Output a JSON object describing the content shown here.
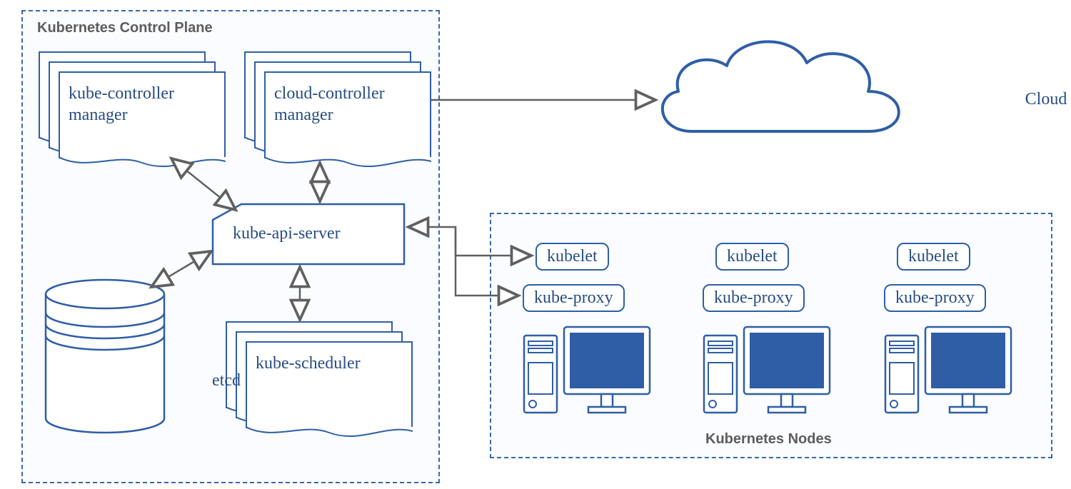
{
  "controlPlane": {
    "title": "Kubernetes Control Plane",
    "kubeControllerManager": "kube-controller\nmanager",
    "cloudControllerManager": "cloud-controller\nmanager",
    "apiServer": "kube-api-server",
    "scheduler": "kube-scheduler",
    "etcd": "etcd"
  },
  "nodesPanel": {
    "title": "Kubernetes Nodes",
    "nodes": [
      {
        "kubelet": "kubelet",
        "kubeproxy": "kube-proxy"
      },
      {
        "kubelet": "kubelet",
        "kubeproxy": "kube-proxy"
      },
      {
        "kubelet": "kubelet",
        "kubeproxy": "kube-proxy"
      }
    ]
  },
  "cloud": {
    "label": "Cloud"
  },
  "colors": {
    "brand": "#2f5ea6",
    "arrow": "#606060",
    "dashed": "#3a68aa"
  }
}
